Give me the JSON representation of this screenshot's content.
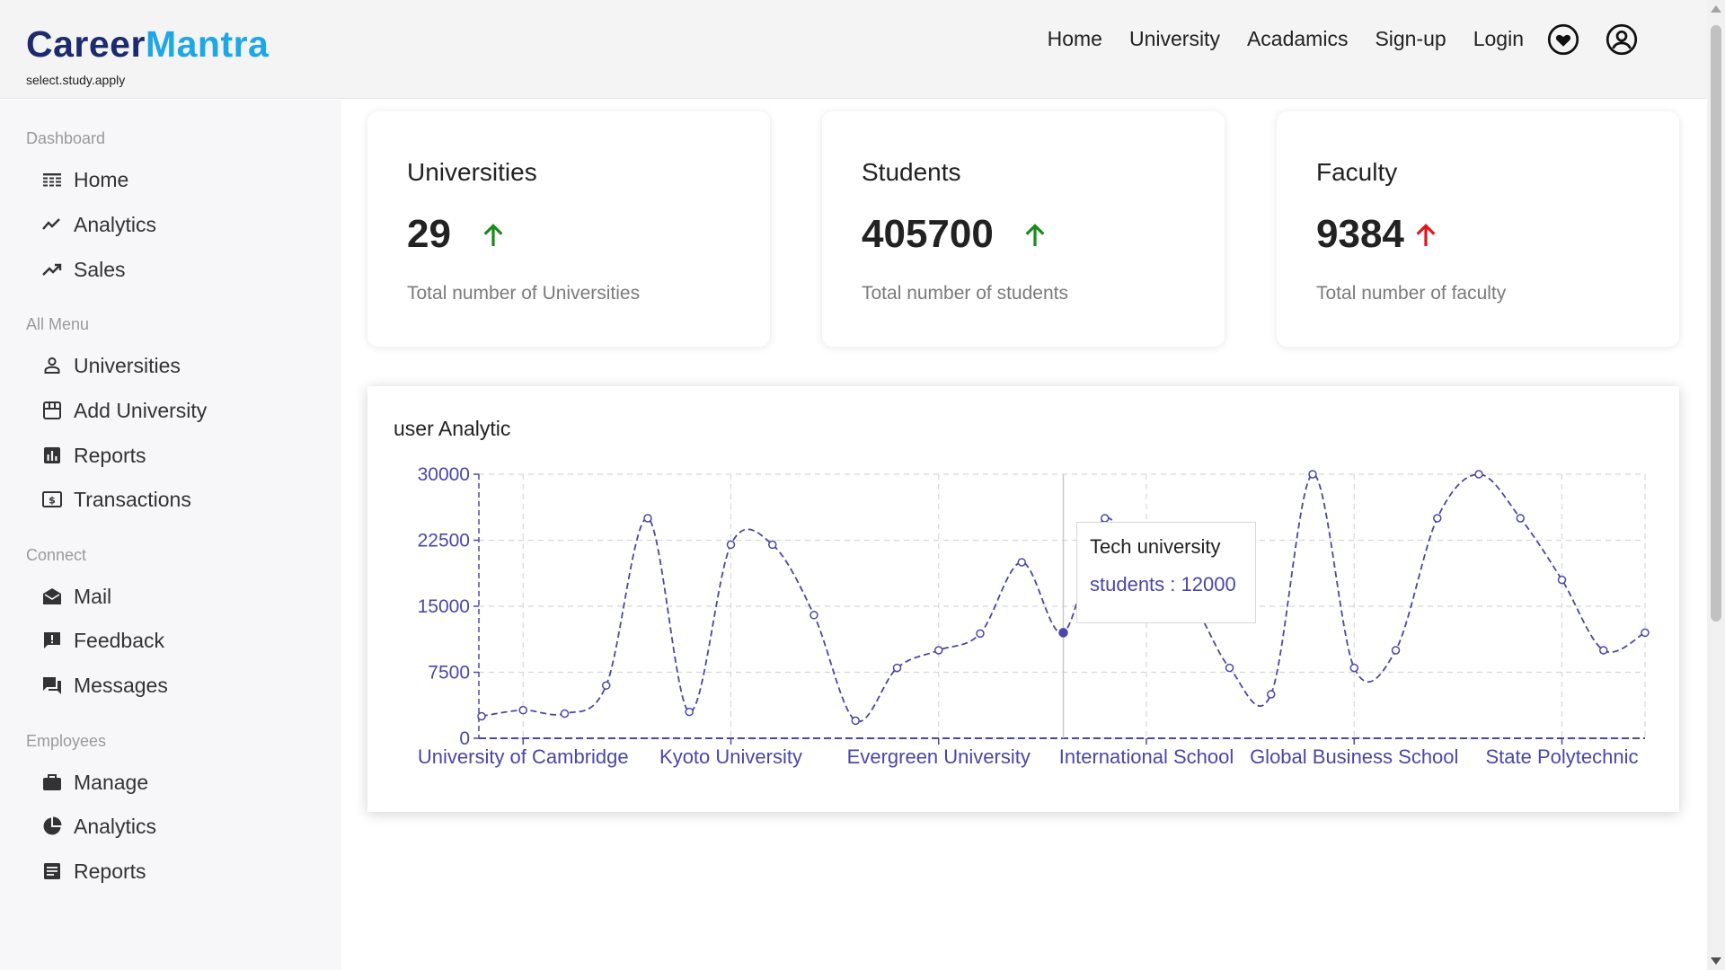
{
  "brand": {
    "name_part1": "Career",
    "name_part2": "Mantra",
    "tagline": "select.study.apply"
  },
  "topnav": {
    "items": [
      "Home",
      "University",
      "Acadamics",
      "Sign-up",
      "Login"
    ],
    "icons": [
      "heart-circle-icon",
      "user-circle-icon"
    ]
  },
  "sidebar": {
    "sections": [
      {
        "label": "Dashboard",
        "items": [
          {
            "label": "Home",
            "icon": "table-icon"
          },
          {
            "label": "Analytics",
            "icon": "line-chart-icon"
          },
          {
            "label": "Sales",
            "icon": "trending-up-icon"
          }
        ]
      },
      {
        "label": "All Menu",
        "items": [
          {
            "label": "Universities",
            "icon": "person-icon"
          },
          {
            "label": "Add University",
            "icon": "store-icon"
          },
          {
            "label": "Reports",
            "icon": "bar-chart-icon"
          },
          {
            "label": "Transactions",
            "icon": "dollar-icon"
          }
        ]
      },
      {
        "label": "Connect",
        "items": [
          {
            "label": "Mail",
            "icon": "mail-icon"
          },
          {
            "label": "Feedback",
            "icon": "feedback-icon"
          },
          {
            "label": "Messages",
            "icon": "chat-icon"
          }
        ]
      },
      {
        "label": "Employees",
        "items": [
          {
            "label": "Manage",
            "icon": "briefcase-icon"
          },
          {
            "label": "Analytics",
            "icon": "pie-chart-icon"
          },
          {
            "label": "Reports",
            "icon": "document-icon"
          }
        ]
      }
    ]
  },
  "cards": [
    {
      "title": "Universities",
      "value": "29",
      "trend": "up",
      "trend_color": "#1a8a1a",
      "desc": "Total number of Universities"
    },
    {
      "title": "Students",
      "value": "405700",
      "trend": "up",
      "trend_color": "#1a8a1a",
      "desc": "Total number of students"
    },
    {
      "title": "Faculty",
      "value": "9384",
      "trend": "up",
      "trend_color": "#e0141a",
      "desc": "Total number of faculty"
    }
  ],
  "chart_title": "user Analytic",
  "tooltip": {
    "title": "Tech university",
    "text": "students : 12000"
  },
  "colors": {
    "series": "#4b46a8",
    "axis": "#4b46a8",
    "grid": "#d8d8d8"
  },
  "chart_data": {
    "type": "line",
    "title": "user Analytic",
    "xlabel": "",
    "ylabel": "",
    "ylim": [
      0,
      30000
    ],
    "yticks": [
      0,
      7500,
      15000,
      22500,
      30000
    ],
    "tick_labels": [
      "University of Cambridge",
      "Kyoto University",
      "Evergreen University",
      "International School",
      "Global Business School",
      "State Polytechnic"
    ],
    "x": [
      0,
      1,
      2,
      3,
      4,
      5,
      6,
      7,
      8,
      9,
      10,
      11,
      12,
      13,
      14,
      15,
      16,
      17,
      18,
      19,
      20,
      21,
      22,
      23,
      24,
      25,
      26,
      27,
      28
    ],
    "tick_indices": [
      1,
      6,
      11,
      16,
      21,
      26
    ],
    "hover_index": 14,
    "series": [
      {
        "values": [
          2500,
          3200,
          2800,
          6000,
          25000,
          3000,
          22000,
          22000,
          14000,
          2000,
          8000,
          10000,
          11900,
          20000,
          12000,
          25000,
          17000,
          16000,
          8000,
          5000,
          30000,
          8000,
          10000,
          25000,
          30000,
          25000,
          18000,
          10000,
          12000
        ]
      }
    ],
    "grid": true,
    "legend": "none"
  }
}
